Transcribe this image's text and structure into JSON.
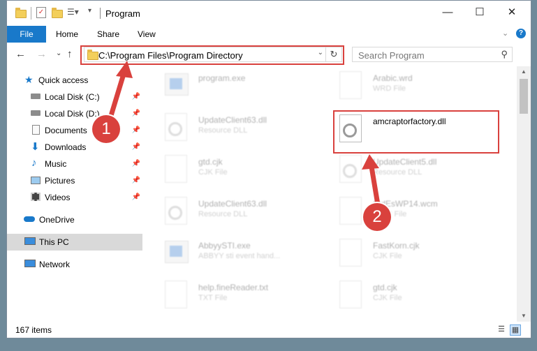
{
  "window": {
    "title": "Program",
    "buttons": {
      "minimize": "—",
      "maximize": "☐",
      "close": "✕"
    }
  },
  "ribbon": {
    "tabs": {
      "file": "File",
      "home": "Home",
      "share": "Share",
      "view": "View"
    },
    "help": "?",
    "collapse": "⌄"
  },
  "address": {
    "path": "C:\\Program Files\\Program Directory",
    "dropdown": "⌄",
    "refresh": "↻"
  },
  "search": {
    "placeholder": "Search Program",
    "icon": "⚲"
  },
  "nav": {
    "back": "←",
    "forward": "→",
    "recent": "⌄",
    "up": "↑",
    "items": [
      {
        "label": "Quick access",
        "icon": "star-icon"
      },
      {
        "label": "Local Disk (C:)",
        "icon": "drive-icon",
        "pinned": true
      },
      {
        "label": "Local Disk (D:)",
        "icon": "drive-icon",
        "pinned": true
      },
      {
        "label": "Documents",
        "icon": "documents-icon",
        "pinned": true
      },
      {
        "label": "Downloads",
        "icon": "downloads-icon",
        "pinned": true
      },
      {
        "label": "Music",
        "icon": "music-icon",
        "pinned": true
      },
      {
        "label": "Pictures",
        "icon": "pictures-icon",
        "pinned": true
      },
      {
        "label": "Videos",
        "icon": "videos-icon",
        "pinned": true
      },
      {
        "label": "OneDrive",
        "icon": "onedrive-icon"
      },
      {
        "label": "This PC",
        "icon": "pc-icon",
        "selected": true
      },
      {
        "label": "Network",
        "icon": "network-icon"
      }
    ]
  },
  "files": {
    "left": [
      {
        "name": "program.exe",
        "type": "",
        "icon": "exe-icon"
      },
      {
        "name": "UpdateClient63.dll",
        "type": "Resource DLL",
        "icon": "dll-icon"
      },
      {
        "name": "gtd.cjk",
        "type": "CJK File",
        "icon": "doc-icon"
      },
      {
        "name": "UpdateClient63.dll",
        "type": "Resource DLL",
        "icon": "dll-icon"
      },
      {
        "name": "AbbyySTI.exe",
        "type": "ABBYY sti event hand...",
        "icon": "exe-icon"
      },
      {
        "name": "help.fineReader.txt",
        "type": "TXT File",
        "icon": "doc-icon"
      }
    ],
    "right": [
      {
        "name": "Arabic.wrd",
        "type": "WRD File",
        "icon": "doc-icon"
      },
      {
        "name": "amcraptorfactory.dll",
        "type": "",
        "icon": "dll-icon",
        "highlighted": true
      },
      {
        "name": "UpdateClient5.dll",
        "type": "Resource DLL",
        "icon": "dll-icon"
      },
      {
        "name": "StdEsWP14.wcm",
        "type": "WCM File",
        "icon": "doc-icon"
      },
      {
        "name": "FastKorn.cjk",
        "type": "CJK File",
        "icon": "doc-icon"
      },
      {
        "name": "gtd.cjk",
        "type": "CJK File",
        "icon": "doc-icon"
      }
    ]
  },
  "status": {
    "items": "167 items"
  },
  "annotations": {
    "step1": "1",
    "step2": "2",
    "color": "#d9413d"
  }
}
